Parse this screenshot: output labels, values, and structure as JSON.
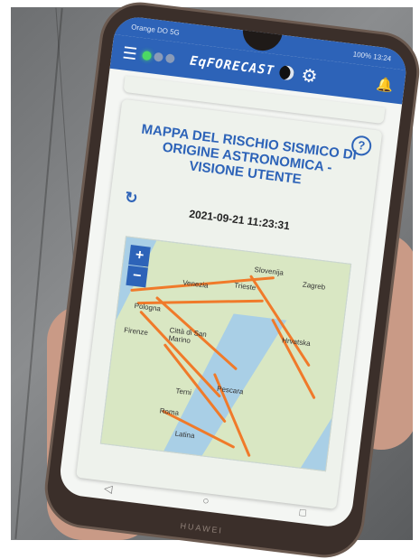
{
  "status_bar": {
    "left": "Orange DO 5G",
    "right": "100% 13:24"
  },
  "app_bar": {
    "title": "EqFORECAST",
    "indicator_colors": [
      "#4cd964",
      "#8a9bb8",
      "#8a9bb8"
    ]
  },
  "card": {
    "title": "MAPPA DEL RISCHIO SISMICO DI ORIGINE ASTRONOMICA - VISIONE UTENTE",
    "timestamp": "2021-09-21 11:23:31",
    "help_label": "?"
  },
  "map": {
    "zoom_in": "+",
    "zoom_out": "−",
    "labels": [
      "Slovenija",
      "Zagreb",
      "Venezia",
      "Trieste",
      "Pologna",
      "Città di San Marino",
      "Firenze",
      "Hrvatska",
      "Roma",
      "Latina",
      "Terni",
      "Pescara"
    ],
    "fault_color": "#f07a2a"
  },
  "nav": {
    "back": "◁",
    "home": "○",
    "recent": "□"
  },
  "brand": "HUAWEI"
}
